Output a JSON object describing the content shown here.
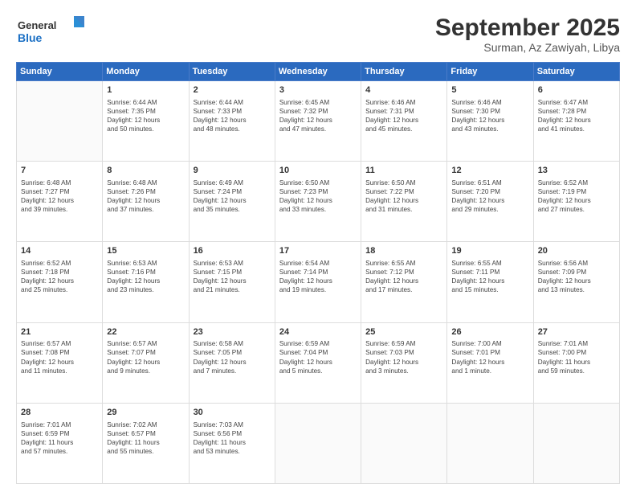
{
  "header": {
    "logo_line1": "General",
    "logo_line2": "Blue",
    "month_year": "September 2025",
    "location": "Surman, Az Zawiyah, Libya"
  },
  "days_of_week": [
    "Sunday",
    "Monday",
    "Tuesday",
    "Wednesday",
    "Thursday",
    "Friday",
    "Saturday"
  ],
  "weeks": [
    [
      {
        "day": "",
        "info": ""
      },
      {
        "day": "1",
        "info": "Sunrise: 6:44 AM\nSunset: 7:35 PM\nDaylight: 12 hours\nand 50 minutes."
      },
      {
        "day": "2",
        "info": "Sunrise: 6:44 AM\nSunset: 7:33 PM\nDaylight: 12 hours\nand 48 minutes."
      },
      {
        "day": "3",
        "info": "Sunrise: 6:45 AM\nSunset: 7:32 PM\nDaylight: 12 hours\nand 47 minutes."
      },
      {
        "day": "4",
        "info": "Sunrise: 6:46 AM\nSunset: 7:31 PM\nDaylight: 12 hours\nand 45 minutes."
      },
      {
        "day": "5",
        "info": "Sunrise: 6:46 AM\nSunset: 7:30 PM\nDaylight: 12 hours\nand 43 minutes."
      },
      {
        "day": "6",
        "info": "Sunrise: 6:47 AM\nSunset: 7:28 PM\nDaylight: 12 hours\nand 41 minutes."
      }
    ],
    [
      {
        "day": "7",
        "info": "Sunrise: 6:48 AM\nSunset: 7:27 PM\nDaylight: 12 hours\nand 39 minutes."
      },
      {
        "day": "8",
        "info": "Sunrise: 6:48 AM\nSunset: 7:26 PM\nDaylight: 12 hours\nand 37 minutes."
      },
      {
        "day": "9",
        "info": "Sunrise: 6:49 AM\nSunset: 7:24 PM\nDaylight: 12 hours\nand 35 minutes."
      },
      {
        "day": "10",
        "info": "Sunrise: 6:50 AM\nSunset: 7:23 PM\nDaylight: 12 hours\nand 33 minutes."
      },
      {
        "day": "11",
        "info": "Sunrise: 6:50 AM\nSunset: 7:22 PM\nDaylight: 12 hours\nand 31 minutes."
      },
      {
        "day": "12",
        "info": "Sunrise: 6:51 AM\nSunset: 7:20 PM\nDaylight: 12 hours\nand 29 minutes."
      },
      {
        "day": "13",
        "info": "Sunrise: 6:52 AM\nSunset: 7:19 PM\nDaylight: 12 hours\nand 27 minutes."
      }
    ],
    [
      {
        "day": "14",
        "info": "Sunrise: 6:52 AM\nSunset: 7:18 PM\nDaylight: 12 hours\nand 25 minutes."
      },
      {
        "day": "15",
        "info": "Sunrise: 6:53 AM\nSunset: 7:16 PM\nDaylight: 12 hours\nand 23 minutes."
      },
      {
        "day": "16",
        "info": "Sunrise: 6:53 AM\nSunset: 7:15 PM\nDaylight: 12 hours\nand 21 minutes."
      },
      {
        "day": "17",
        "info": "Sunrise: 6:54 AM\nSunset: 7:14 PM\nDaylight: 12 hours\nand 19 minutes."
      },
      {
        "day": "18",
        "info": "Sunrise: 6:55 AM\nSunset: 7:12 PM\nDaylight: 12 hours\nand 17 minutes."
      },
      {
        "day": "19",
        "info": "Sunrise: 6:55 AM\nSunset: 7:11 PM\nDaylight: 12 hours\nand 15 minutes."
      },
      {
        "day": "20",
        "info": "Sunrise: 6:56 AM\nSunset: 7:09 PM\nDaylight: 12 hours\nand 13 minutes."
      }
    ],
    [
      {
        "day": "21",
        "info": "Sunrise: 6:57 AM\nSunset: 7:08 PM\nDaylight: 12 hours\nand 11 minutes."
      },
      {
        "day": "22",
        "info": "Sunrise: 6:57 AM\nSunset: 7:07 PM\nDaylight: 12 hours\nand 9 minutes."
      },
      {
        "day": "23",
        "info": "Sunrise: 6:58 AM\nSunset: 7:05 PM\nDaylight: 12 hours\nand 7 minutes."
      },
      {
        "day": "24",
        "info": "Sunrise: 6:59 AM\nSunset: 7:04 PM\nDaylight: 12 hours\nand 5 minutes."
      },
      {
        "day": "25",
        "info": "Sunrise: 6:59 AM\nSunset: 7:03 PM\nDaylight: 12 hours\nand 3 minutes."
      },
      {
        "day": "26",
        "info": "Sunrise: 7:00 AM\nSunset: 7:01 PM\nDaylight: 12 hours\nand 1 minute."
      },
      {
        "day": "27",
        "info": "Sunrise: 7:01 AM\nSunset: 7:00 PM\nDaylight: 11 hours\nand 59 minutes."
      }
    ],
    [
      {
        "day": "28",
        "info": "Sunrise: 7:01 AM\nSunset: 6:59 PM\nDaylight: 11 hours\nand 57 minutes."
      },
      {
        "day": "29",
        "info": "Sunrise: 7:02 AM\nSunset: 6:57 PM\nDaylight: 11 hours\nand 55 minutes."
      },
      {
        "day": "30",
        "info": "Sunrise: 7:03 AM\nSunset: 6:56 PM\nDaylight: 11 hours\nand 53 minutes."
      },
      {
        "day": "",
        "info": ""
      },
      {
        "day": "",
        "info": ""
      },
      {
        "day": "",
        "info": ""
      },
      {
        "day": "",
        "info": ""
      }
    ]
  ]
}
